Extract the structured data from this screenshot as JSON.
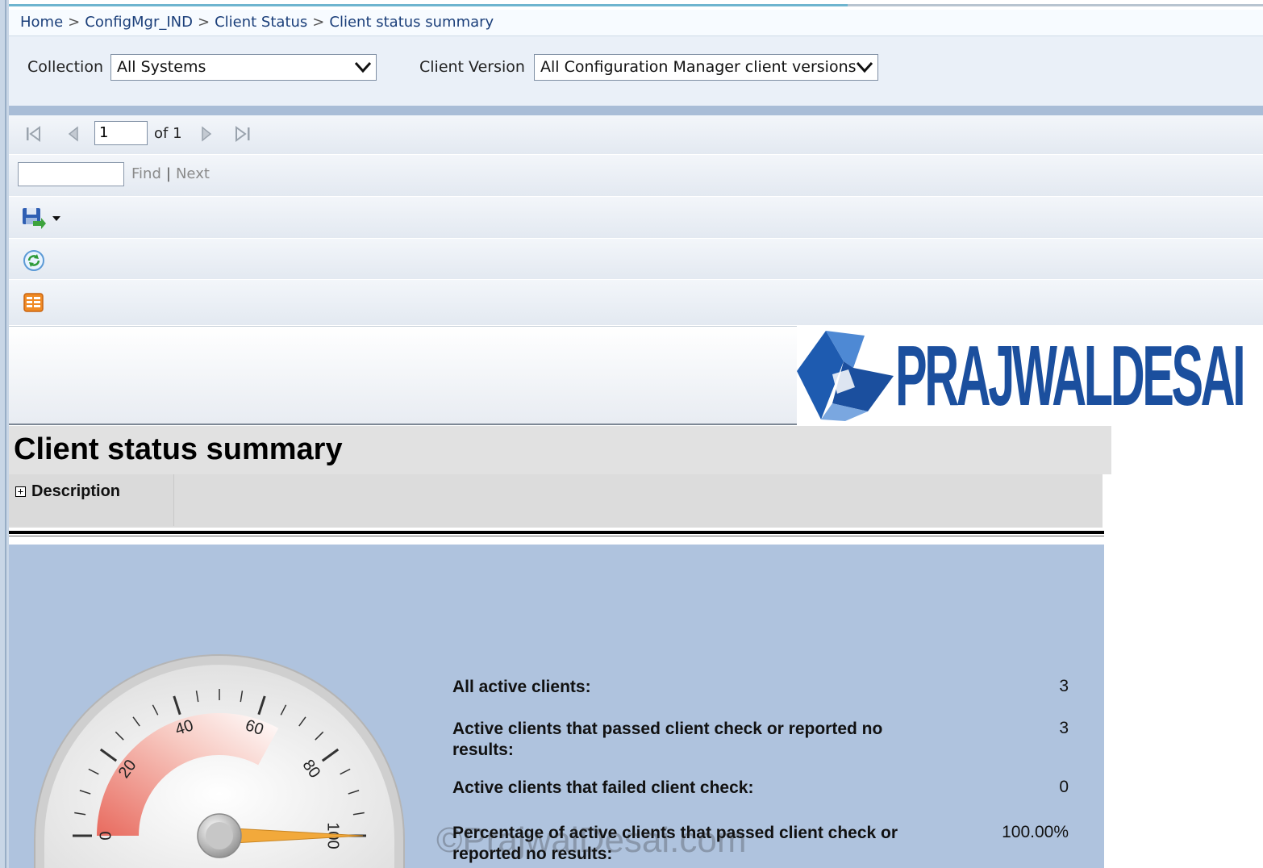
{
  "breadcrumb": [
    "Home",
    "ConfigMgr_IND",
    "Client Status",
    "Client status summary"
  ],
  "breadcrumb_separator": ">",
  "params": {
    "collection_label": "Collection",
    "collection_value": "All Systems",
    "client_version_label": "Client Version",
    "client_version_value": "All Configuration Manager client versions"
  },
  "toolbar": {
    "page_current": "1",
    "page_of": "of 1",
    "find_label": "Find",
    "find_separator": "|",
    "next_label": "Next",
    "icons": [
      "first-page-icon",
      "previous-page-icon",
      "next-page-icon",
      "last-page-icon",
      "save-export-icon",
      "dropdown-arrow-icon",
      "refresh-icon",
      "print-layout-icon"
    ]
  },
  "logo": {
    "text": "PRAJWALDESAI"
  },
  "report": {
    "title": "Client status summary",
    "description_toggle": "+",
    "description_label": "Description"
  },
  "gauge": {
    "min": 0,
    "max": 100,
    "tick_labels": [
      "0",
      "20",
      "40",
      "60",
      "80",
      "100"
    ],
    "needle_value": 100,
    "ranges": [
      {
        "from": 0,
        "to": 66,
        "color": "#e86a5e"
      }
    ]
  },
  "stats": [
    {
      "label": "All active clients:",
      "value": "3"
    },
    {
      "label": "Active clients that passed client check or reported no results:",
      "value": "3"
    },
    {
      "label": "Active clients that failed client check:",
      "value": "0"
    },
    {
      "label": "Percentage of active clients that passed client check or reported no results:",
      "value": "100.00%"
    }
  ],
  "watermark": "©PrajwalDesai.com",
  "colors": {
    "breadcrumb_link": "#1b3f7a",
    "panel_bg": "#afc3de",
    "logo_blue": "#1b4f9e",
    "needle": "#f2a93b"
  }
}
